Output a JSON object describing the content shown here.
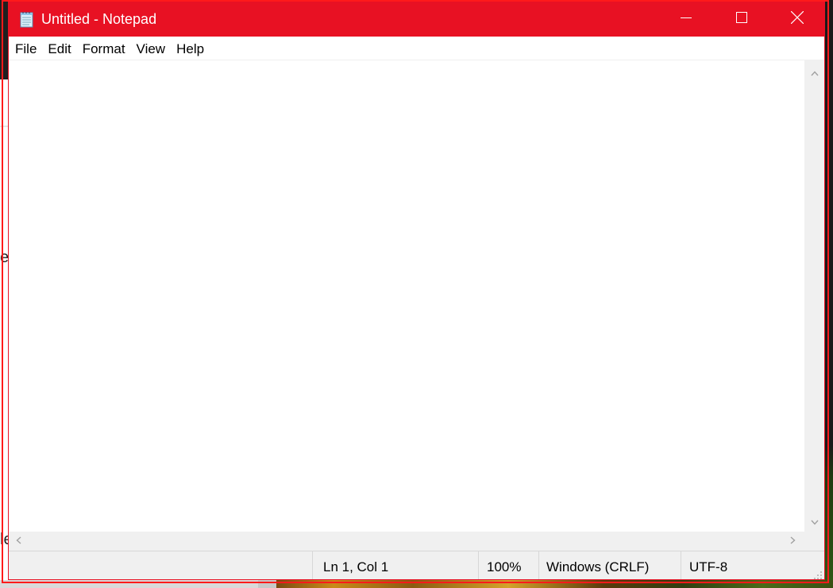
{
  "window": {
    "title": "Untitled - Notepad",
    "app_icon": "notepad-icon",
    "controls": {
      "minimize_icon": "minimize-icon",
      "maximize_icon": "maximize-icon",
      "close_icon": "close-icon"
    },
    "titlebar_color": "#e81123"
  },
  "menu": {
    "items": [
      {
        "label": "File"
      },
      {
        "label": "Edit"
      },
      {
        "label": "Format"
      },
      {
        "label": "View"
      },
      {
        "label": "Help"
      }
    ]
  },
  "editor": {
    "content": ""
  },
  "statusbar": {
    "position": "Ln 1, Col 1",
    "zoom": "100%",
    "line_ending": "Windows (CRLF)",
    "encoding": "UTF-8"
  },
  "background": {
    "left_chars": [
      "e",
      "le"
    ]
  }
}
